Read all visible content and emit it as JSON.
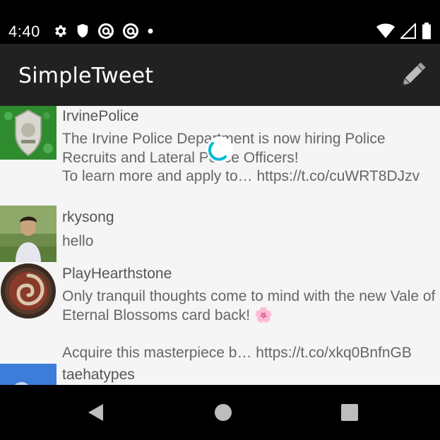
{
  "status_bar": {
    "time": "4:40",
    "left_icons": [
      "gear-icon",
      "shield-icon",
      "at-sign-icon",
      "at-sign-icon",
      "dot-icon"
    ],
    "right_icons": [
      "wifi-icon",
      "signal-icon",
      "battery-icon"
    ]
  },
  "app_bar": {
    "title": "SimpleTweet",
    "compose_icon": "pencil-icon"
  },
  "tweets": [
    {
      "username": "IrvinePolice",
      "body": "The Irvine Police Department is now hiring Police Recruits and Lateral Police Officers!\nTo learn more and apply to… https://t.co/cuWRT8DJzv"
    },
    {
      "username": "rkysong",
      "body": "hello"
    },
    {
      "username": "PlayHearthstone",
      "body": "Only tranquil thoughts come to mind with the new Vale of Eternal Blossoms card back! 🌸\n\nAcquire this masterpiece b… https://t.co/xkq0BnfnGB"
    },
    {
      "username": "taehatypes",
      "body": ""
    }
  ],
  "nav_bar": {
    "back_icon": "back-triangle-icon",
    "home_icon": "home-circle-icon",
    "recents_icon": "recents-square-icon"
  },
  "colors": {
    "app_bar": "#212121",
    "timeline_bg": "#f5f5f5",
    "loader": "#00bcd4"
  }
}
